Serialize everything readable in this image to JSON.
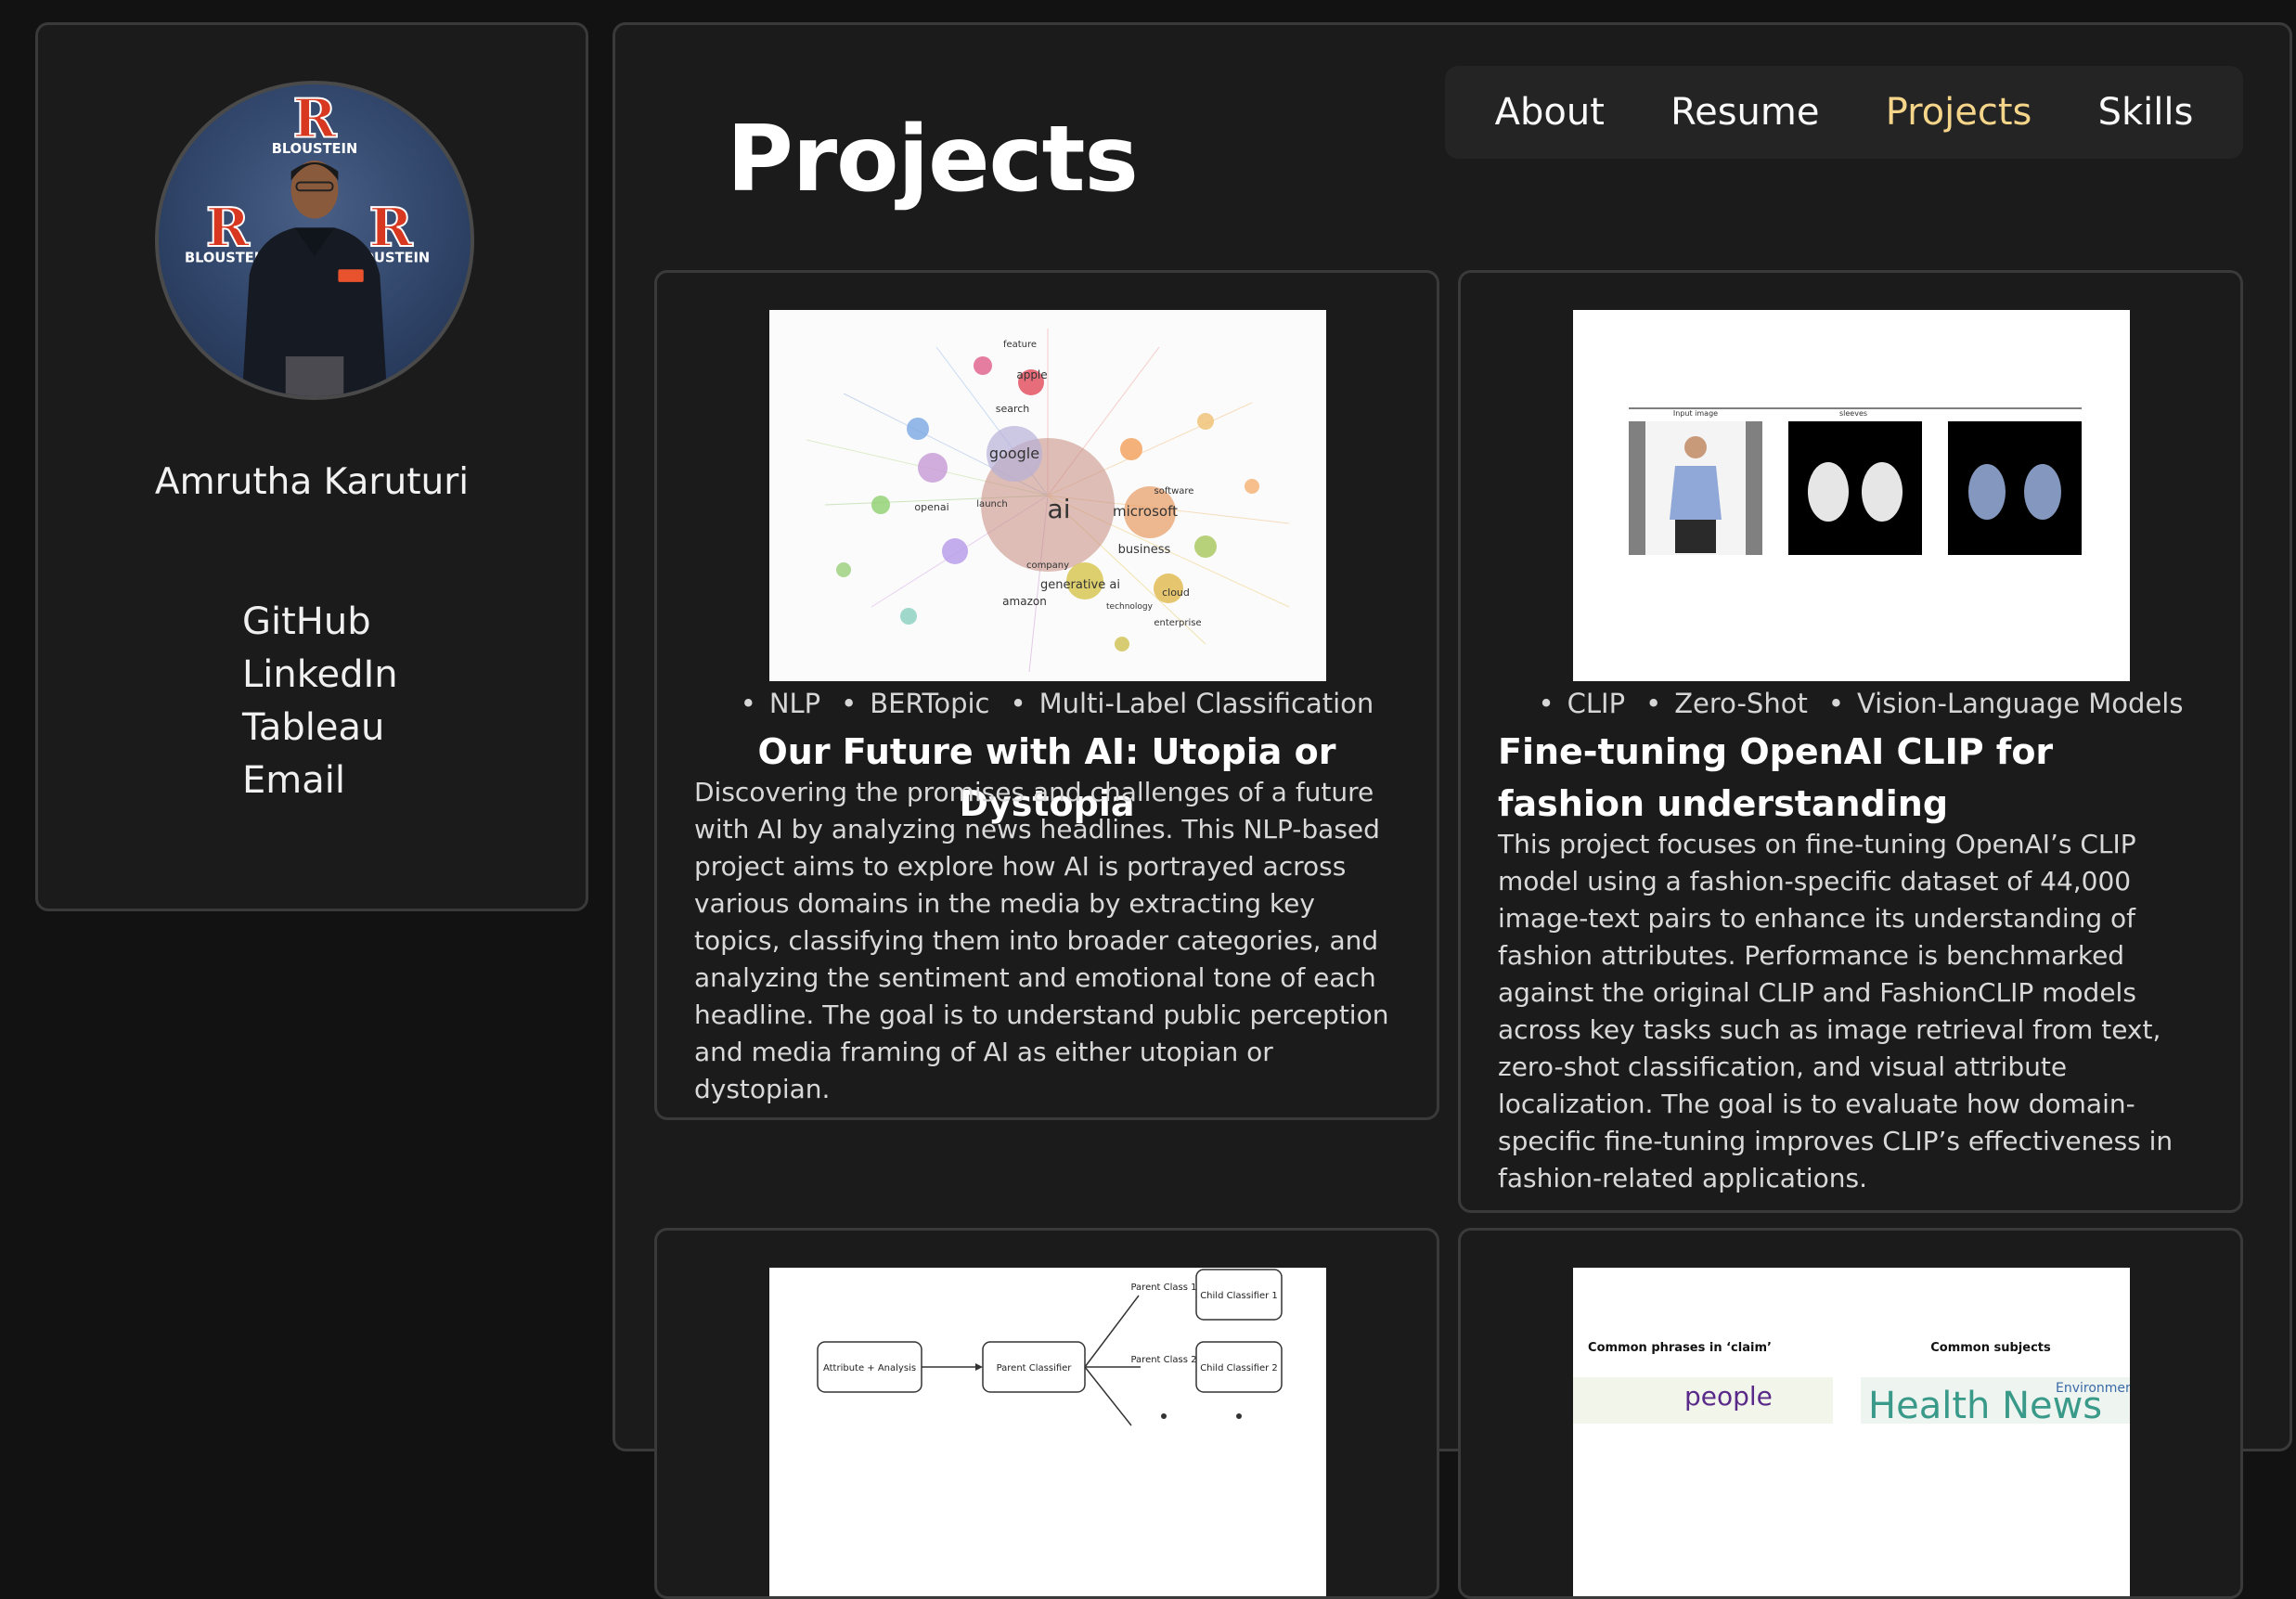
{
  "profile": {
    "name": "Amrutha Karuturi",
    "avatar_text": {
      "logo": "R",
      "org": "BLOUSTEIN",
      "org_partial": "OUSTEIN"
    }
  },
  "links": {
    "github": "GitHub",
    "linkedin": "LinkedIn",
    "tableau": "Tableau",
    "email": "Email"
  },
  "page_title": "Projects",
  "nav": {
    "about": "About",
    "resume": "Resume",
    "projects": "Projects",
    "skills": "Skills",
    "active": "Projects"
  },
  "projects": [
    {
      "tags": [
        "NLP",
        "BERTopic",
        "Multi-Label Classification"
      ],
      "title": "Our Future with AI: Utopia or Dystopia",
      "description": "Discovering the promises and challenges of a future with AI by analyzing news headlines. This NLP-based project aims to explore how AI is portrayed across various domains in the media by extracting key topics, classifying them into broader categories, and analyzing the sentiment and emotional tone of each headline. The goal is to understand public perception and media framing of AI as either utopian or dystopian.",
      "image_labels": [
        "ai",
        "google",
        "microsoft",
        "generative ai",
        "business",
        "amazon",
        "apple",
        "openai",
        "search",
        "cloud",
        "technology",
        "company",
        "feature",
        "launch",
        "enterprise",
        "software"
      ]
    },
    {
      "tags": [
        "CLIP",
        "Zero-Shot",
        "Vision-Language Models"
      ],
      "title": "Fine-tuning OpenAI CLIP for fashion understanding",
      "description": "This project focuses on fine-tuning OpenAI’s CLIP model using a fashion-specific dataset of 44,000 image-text pairs to enhance its understanding of fashion attributes. Performance is benchmarked against the original CLIP and FashionCLIP models across key tasks such as image retrieval from text, zero-shot classification, and visual attribute localization. The goal is to evaluate how domain-specific fine-tuning improves CLIP’s effectiveness in fashion-related applications.",
      "image_labels": [
        "Input image",
        "sleeves"
      ]
    },
    {
      "image_labels": [
        "Attribute + Analysis",
        "Parent Classifier",
        "Parent Class 1",
        "Parent Class 2",
        "Child Classifier 1",
        "Child Classifier 2"
      ]
    },
    {
      "image_labels": [
        "Common phrases in ‘claim’",
        "Common subjects",
        "people",
        "Health News",
        "Environment"
      ]
    }
  ],
  "colors": {
    "background": "#121212",
    "panel": "#1b1b1b",
    "border": "#3a3a3a",
    "nav_active": "#f5d58a",
    "rutgers_red": "#d8381f"
  }
}
